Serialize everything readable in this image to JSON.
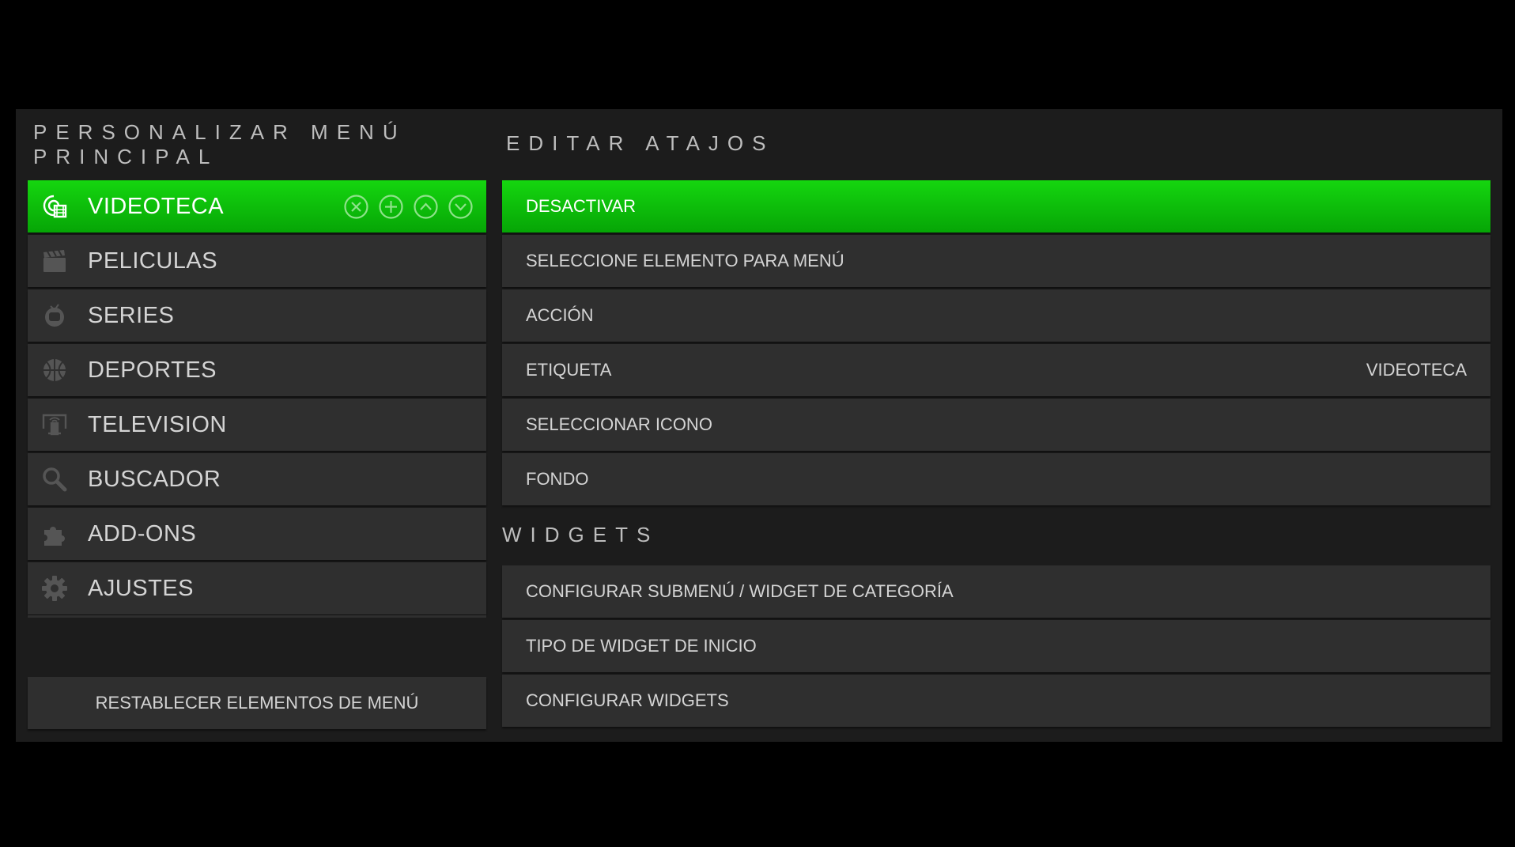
{
  "left_panel": {
    "title": "PERSONALIZAR MENÚ PRINCIPAL",
    "items": [
      {
        "label": "VIDEOTECA",
        "icon": "video-library-icon",
        "selected": true
      },
      {
        "label": "PELICULAS",
        "icon": "clapperboard-icon",
        "selected": false
      },
      {
        "label": "SERIES",
        "icon": "tv-icon",
        "selected": false
      },
      {
        "label": "DEPORTES",
        "icon": "basketball-icon",
        "selected": false
      },
      {
        "label": "TELEVISION",
        "icon": "live-tv-icon",
        "selected": false
      },
      {
        "label": "BUSCADOR",
        "icon": "search-icon",
        "selected": false
      },
      {
        "label": "ADD-ONS",
        "icon": "puzzle-icon",
        "selected": false
      },
      {
        "label": "AJUSTES",
        "icon": "gear-icon",
        "selected": false
      }
    ],
    "item_actions": [
      "remove-icon",
      "add-icon",
      "move-up-icon",
      "move-down-icon"
    ],
    "reset_label": "RESTABLECER ELEMENTOS DE MENÚ"
  },
  "right_panel": {
    "title": "EDITAR ATAJOS",
    "options": [
      {
        "label": "DESACTIVAR",
        "value": "",
        "selected": true
      },
      {
        "label": "SELECCIONE ELEMENTO PARA MENÚ",
        "value": ""
      },
      {
        "label": "ACCIÓN",
        "value": ""
      },
      {
        "label": "ETIQUETA",
        "value": "VIDEOTECA"
      },
      {
        "label": "SELECCIONAR ICONO",
        "value": ""
      },
      {
        "label": "FONDO",
        "value": ""
      }
    ],
    "widgets_title": "WIDGETS",
    "widget_options": [
      {
        "label": "CONFIGURAR SUBMENÚ / WIDGET DE CATEGORÍA"
      },
      {
        "label": "TIPO DE WIDGET DE INICIO"
      },
      {
        "label": "CONFIGURAR WIDGETS"
      }
    ]
  },
  "colors": {
    "accent": "#10c20c",
    "background": "#000000",
    "panel": "#1c1c1c",
    "item": "#2f2f2f"
  }
}
